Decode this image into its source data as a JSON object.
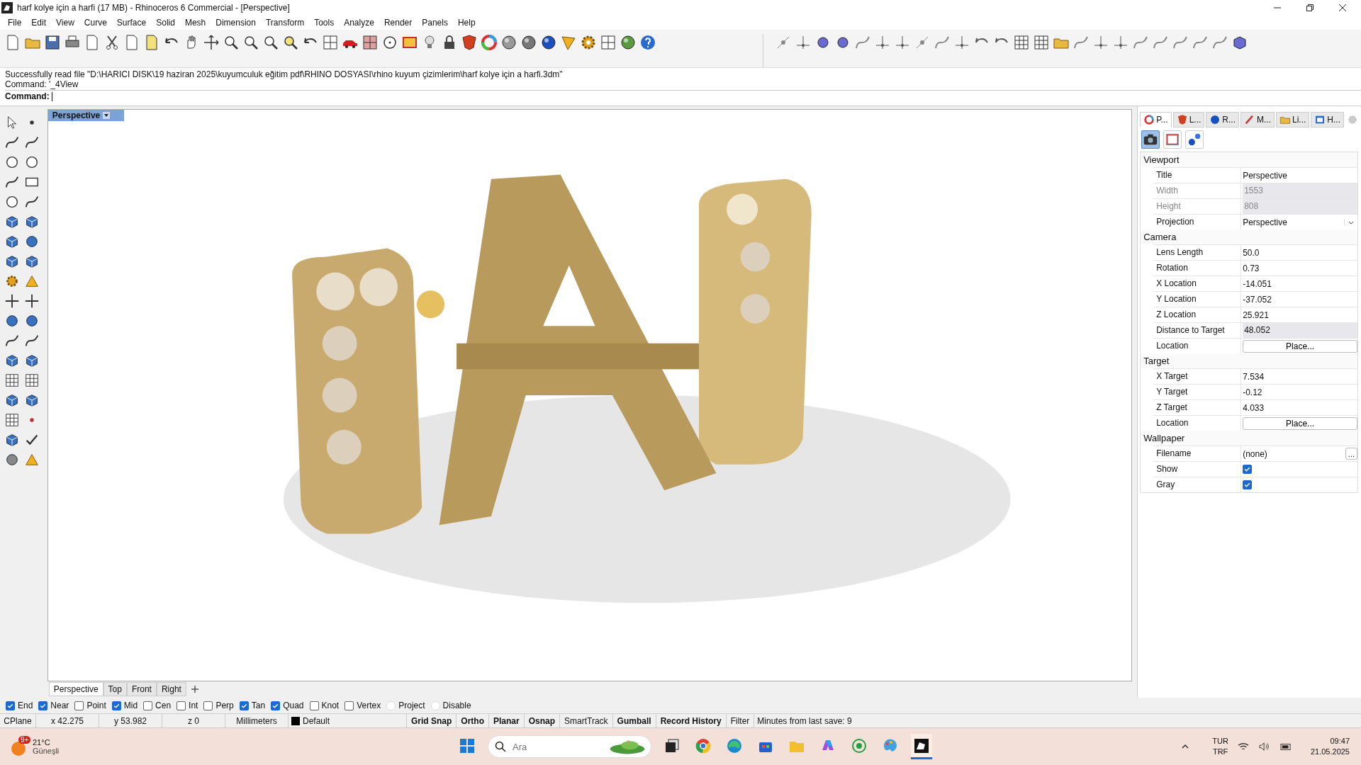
{
  "window": {
    "title": "harf kolye için a harfi (17 MB) - Rhinoceros 6 Commercial - [Perspective]"
  },
  "menu": [
    "File",
    "Edit",
    "View",
    "Curve",
    "Surface",
    "Solid",
    "Mesh",
    "Dimension",
    "Transform",
    "Tools",
    "Analyze",
    "Render",
    "Panels",
    "Help"
  ],
  "command_history": [
    "Successfully read file \"D:\\HARICI DISK\\19 haziran 2025\\kuyumculuk eğitim pdf\\RHINO DOSYASI\\rhino kuyum çizimlerim\\harf kolye için a harfi.3dm\"",
    "Command: '_4View"
  ],
  "command_prompt": {
    "label": "Command:"
  },
  "viewport": {
    "title": "Perspective",
    "kind": "picture"
  },
  "viewport_tabs": [
    {
      "label": "Perspective",
      "selected": true
    },
    {
      "label": "Top",
      "selected": false
    },
    {
      "label": "Front",
      "selected": false
    },
    {
      "label": "Right",
      "selected": false
    }
  ],
  "panel_tabs": [
    {
      "label": "P...",
      "kind": "wheel",
      "selected": true
    },
    {
      "label": "L...",
      "kind": "layers",
      "selected": false
    },
    {
      "label": "R...",
      "kind": "sphere",
      "selected": false
    },
    {
      "label": "M...",
      "kind": "pencil",
      "selected": false
    },
    {
      "label": "Li...",
      "kind": "folder",
      "selected": false
    },
    {
      "label": "H...",
      "kind": "help",
      "selected": false
    }
  ],
  "panel_views": [
    {
      "kind": "camera",
      "selected": true
    },
    {
      "kind": "frame",
      "selected": false
    },
    {
      "kind": "spheres",
      "selected": false
    }
  ],
  "sections": [
    {
      "title": "Viewport",
      "rows": [
        {
          "label": "Title",
          "value": "Perspective",
          "kind": "text",
          "disabled": false
        },
        {
          "label": "Width",
          "value": "1553",
          "kind": "readonly",
          "disabled": true
        },
        {
          "label": "Height",
          "value": "808",
          "kind": "readonly",
          "disabled": true
        },
        {
          "label": "Projection",
          "value": "Perspective",
          "kind": "dropdown",
          "disabled": false
        }
      ]
    },
    {
      "title": "Camera",
      "rows": [
        {
          "label": "Lens Length",
          "value": "50.0",
          "kind": "text",
          "disabled": false
        },
        {
          "label": "Rotation",
          "value": "0.73",
          "kind": "text",
          "disabled": false
        },
        {
          "label": "X Location",
          "value": "-14.051",
          "kind": "text",
          "disabled": false
        },
        {
          "label": "Y Location",
          "value": "-37.052",
          "kind": "text",
          "disabled": false
        },
        {
          "label": "Z Location",
          "value": "25.921",
          "kind": "text",
          "disabled": false
        },
        {
          "label": "Distance to Target",
          "value": "48.052",
          "kind": "readonly",
          "disabled": false
        },
        {
          "label": "Location",
          "value": "Place...",
          "kind": "button",
          "disabled": false
        }
      ]
    },
    {
      "title": "Target",
      "rows": [
        {
          "label": "X Target",
          "value": "7.534",
          "kind": "text",
          "disabled": false
        },
        {
          "label": "Y Target",
          "value": "-0.12",
          "kind": "text",
          "disabled": false
        },
        {
          "label": "Z Target",
          "value": "4.033",
          "kind": "text",
          "disabled": false
        },
        {
          "label": "Location",
          "value": "Place...",
          "kind": "button",
          "disabled": false
        }
      ]
    },
    {
      "title": "Wallpaper",
      "rows": [
        {
          "label": "Filename",
          "value": "(none)",
          "button": "...",
          "kind": "file",
          "disabled": false
        },
        {
          "label": "Show",
          "kind": "checkbox",
          "checked": true,
          "disabled": false
        },
        {
          "label": "Gray",
          "kind": "checkbox",
          "checked": true,
          "disabled": false
        }
      ]
    }
  ],
  "osnaps": [
    {
      "label": "End",
      "checked": true,
      "disabled": false
    },
    {
      "label": "Near",
      "checked": true,
      "disabled": false
    },
    {
      "label": "Point",
      "checked": false,
      "disabled": false
    },
    {
      "label": "Mid",
      "checked": true,
      "disabled": false
    },
    {
      "label": "Cen",
      "checked": false,
      "disabled": false
    },
    {
      "label": "Int",
      "checked": false,
      "disabled": false
    },
    {
      "label": "Perp",
      "checked": false,
      "disabled": false
    },
    {
      "label": "Tan",
      "checked": true,
      "disabled": false
    },
    {
      "label": "Quad",
      "checked": true,
      "disabled": false
    },
    {
      "label": "Knot",
      "checked": false,
      "disabled": false
    },
    {
      "label": "Vertex",
      "checked": false,
      "disabled": false
    },
    {
      "label": "Project",
      "checked": false,
      "disabled": true
    },
    {
      "label": "Disable",
      "checked": false,
      "disabled": true
    }
  ],
  "status_bar": {
    "cells": [
      {
        "text": "CPlane",
        "kind": "plain"
      },
      {
        "text": "x 42.275",
        "kind": "coord"
      },
      {
        "text": "y 53.982",
        "kind": "coord"
      },
      {
        "text": "z 0",
        "kind": "coord"
      },
      {
        "text": "Millimeters",
        "kind": "coord"
      },
      {
        "text": "Default",
        "kind": "layer"
      }
    ],
    "toggles": [
      {
        "label": "Grid Snap",
        "on": true
      },
      {
        "label": "Ortho",
        "on": true
      },
      {
        "label": "Planar",
        "on": true
      },
      {
        "label": "Osnap",
        "on": true
      },
      {
        "label": "SmartTrack",
        "on": false
      },
      {
        "label": "Gumball",
        "on": true
      },
      {
        "label": "Record History",
        "on": true
      },
      {
        "label": "Filter",
        "on": false
      }
    ],
    "save_info": "Minutes from last save: 9"
  },
  "taskbar": {
    "weather": {
      "badge": "9+",
      "temperature": "21°C",
      "condition": "Güneşli"
    },
    "search": {
      "placeholder": "Ara"
    },
    "apps": [
      {
        "kind": "start",
        "active": false
      },
      {
        "kind": "taskview",
        "active": false
      },
      {
        "kind": "chrome",
        "active": false
      },
      {
        "kind": "edge",
        "active": false
      },
      {
        "kind": "store",
        "active": false
      },
      {
        "kind": "folder",
        "active": false
      },
      {
        "kind": "copilot",
        "active": false
      },
      {
        "kind": "whatsapp",
        "active": false
      },
      {
        "kind": "paint",
        "active": false
      },
      {
        "kind": "rhino",
        "active": true
      }
    ],
    "language": "TUR",
    "layout": "TRF",
    "time": "09:47",
    "date": "21.05.2025"
  }
}
